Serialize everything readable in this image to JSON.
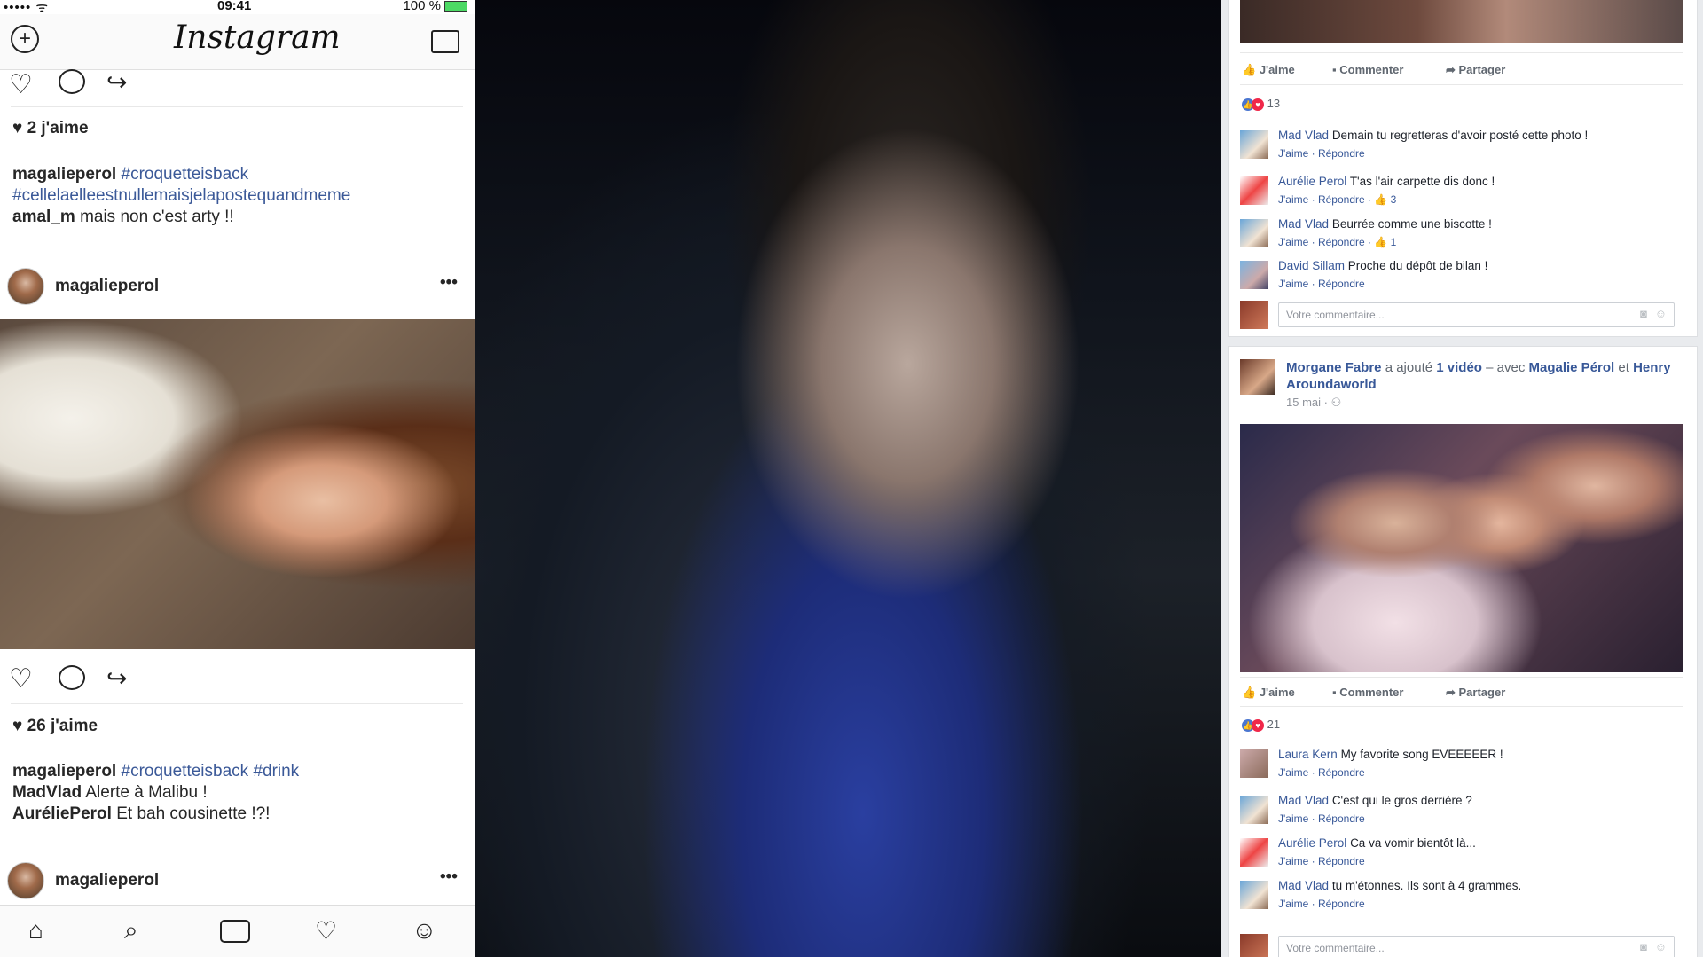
{
  "instagram": {
    "status": {
      "carrier": "••••• ᯤ",
      "time": "09:41",
      "battery": "100 %"
    },
    "app_title": "Instagram",
    "post1": {
      "likes": "2 j'aime",
      "caption_user": "magalieperol",
      "caption_tag1": "#croquetteisback",
      "caption_tag2": "#cellelaelleestnullemaisjelapostequandmeme",
      "comment1_user": "amal_m",
      "comment1_text": "mais non c'est arty !!"
    },
    "post2": {
      "user": "magalieperol",
      "more": "•••",
      "likes": "26 j'aime",
      "caption_user": "magalieperol",
      "caption_tag1": "#croquetteisback",
      "caption_tag2": "#drink",
      "comment1_user": "MadVlad",
      "comment1_text": "Alerte à Malibu !",
      "comment2_user": "AuréliePerol",
      "comment2_text": "Et bah cousinette !?!"
    },
    "post3": {
      "user": "magalieperol",
      "more": "•••"
    }
  },
  "facebook": {
    "actions": {
      "like": "J'aime",
      "comment": "Commenter",
      "share": "Partager"
    },
    "post1": {
      "reaction_count": "13",
      "comments": [
        {
          "name": "Mad Vlad",
          "text": "Demain tu regretteras d'avoir posté cette photo !",
          "meta": "J'aime · Répondre",
          "likes": ""
        },
        {
          "name": "Aurélie Perol",
          "text": "T'as l'air carpette dis donc !",
          "meta": "J'aime · Répondre",
          "likes": "· 👍 3"
        },
        {
          "name": "Mad Vlad",
          "text": "Beurrée comme une biscotte !",
          "meta": "J'aime · Répondre",
          "likes": "· 👍 1"
        },
        {
          "name": "David Sillam",
          "text": "Proche du dépôt de bilan !",
          "meta": "J'aime · Répondre",
          "likes": ""
        }
      ],
      "comment_placeholder": "Votre commentaire..."
    },
    "post2": {
      "author": "Morgane Fabre",
      "action": "a ajouté",
      "object": "1 vidéo",
      "with": "– avec",
      "tag1": "Magalie Pérol",
      "and": "et",
      "tag2": "Henry Aroundaworld",
      "date": "15 mai",
      "reaction_count": "21",
      "comments": [
        {
          "name": "Laura Kern",
          "text": "My favorite song EVEEEEER !",
          "meta": "J'aime · Répondre"
        },
        {
          "name": "Mad Vlad",
          "text": "C'est qui le gros derrière ?",
          "meta": "J'aime · Répondre"
        },
        {
          "name": "Aurélie Perol",
          "text": "Ca va vomir bientôt là...",
          "meta": "J'aime · Répondre"
        },
        {
          "name": "Mad Vlad",
          "text": "tu m'étonnes. Ils sont à 4 grammes.",
          "meta": "J'aime · Répondre"
        }
      ],
      "comment_placeholder": "Votre commentaire..."
    }
  },
  "colors": {
    "fb_link": "#385898",
    "ig_tag": "#3b5998",
    "fb_bg": "#e9ebee"
  },
  "icons": [
    "add-icon",
    "inbox-icon",
    "heart-icon",
    "comment-icon",
    "share-icon",
    "home-icon",
    "search-icon",
    "camera-icon",
    "activity-icon",
    "profile-icon",
    "thumb-up-icon",
    "camera-small-icon",
    "emoji-icon"
  ]
}
